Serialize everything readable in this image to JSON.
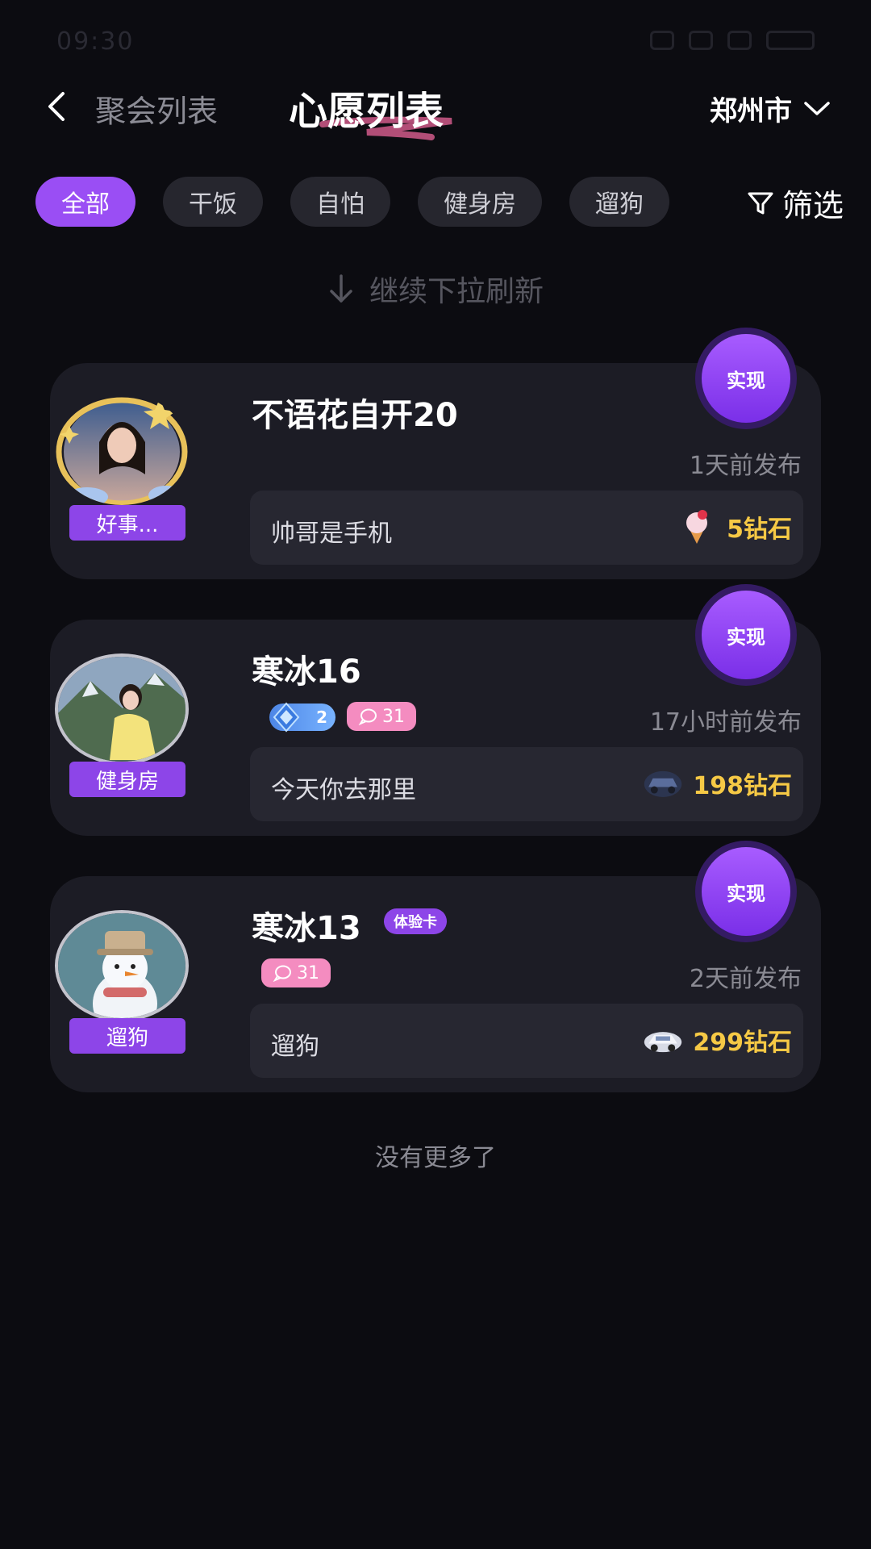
{
  "status": {
    "time": "09:30"
  },
  "header": {
    "back_label": "聚会列表",
    "title": "心愿列表",
    "city": "郑州市"
  },
  "filters": {
    "chips": [
      "全部",
      "干饭",
      "自怕",
      "健身房",
      "遛狗"
    ],
    "active_index": 0,
    "filter_label": "筛选"
  },
  "pull_hint": "继续下拉刷新",
  "colors": {
    "accent": "#9a4ef4",
    "price": "#f6c945",
    "background": "#0c0c11",
    "card": "#1c1c25"
  },
  "cards": [
    {
      "username": "不语花自开20",
      "tag": "好事...",
      "posted": "1天前发布",
      "wish": "帅哥是手机",
      "price": "5钻石",
      "gift_icon": "ice-cream-icon",
      "action": "实现"
    },
    {
      "username": "寒冰16",
      "tag": "健身房",
      "posted": "17小时前发布",
      "level": "2",
      "comments": "31",
      "wish": "今天你去那里",
      "price": "198钻石",
      "gift_icon": "car-icon",
      "action": "实现"
    },
    {
      "username": "寒冰13",
      "tag": "遛狗",
      "trial_badge": "体验卡",
      "posted": "2天前发布",
      "comments": "31",
      "wish": "遛狗",
      "price": "299钻石",
      "gift_icon": "car-icon",
      "action": "实现"
    }
  ],
  "footer_text": "没有更多了"
}
